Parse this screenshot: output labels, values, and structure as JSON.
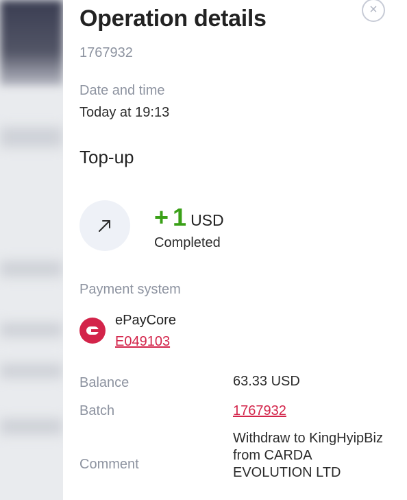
{
  "modal": {
    "title": "Operation details",
    "operation_id": "1767932",
    "close_symbol": "×"
  },
  "datetime": {
    "label": "Date and time",
    "value": "Today at 19:13"
  },
  "operation": {
    "type": "Top-up",
    "icon": "arrow-up-right-icon",
    "sign": "+",
    "amount": "1",
    "currency": "USD",
    "status": "Completed"
  },
  "payment_system": {
    "label": "Payment system",
    "icon": "epaycore-logo-icon",
    "name": "ePayCore",
    "account": "E049103"
  },
  "details": {
    "balance_label": "Balance",
    "balance_value": "63.33 USD",
    "batch_label": "Batch",
    "batch_value": "1767932",
    "comment_label": "Comment",
    "comment_value": "Withdraw to KingHyipBiz from CARDA EVOLUTION LTD"
  },
  "colors": {
    "accent": "#d3244a",
    "positive": "#3aa017",
    "muted_text": "#8d93a0"
  }
}
